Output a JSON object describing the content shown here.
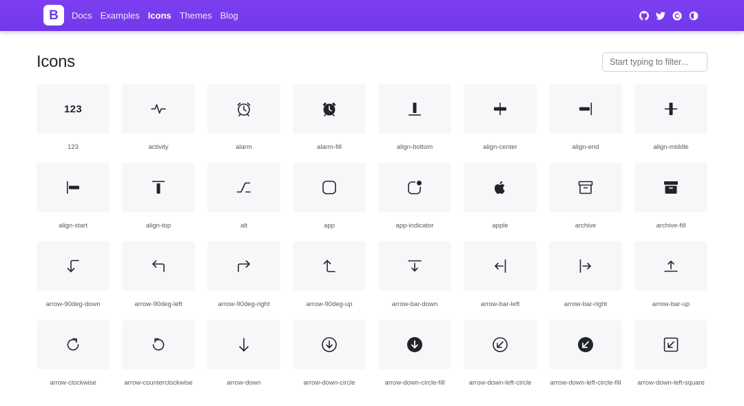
{
  "nav": {
    "brand_letter": "B",
    "links": [
      {
        "label": "Docs",
        "active": false
      },
      {
        "label": "Examples",
        "active": false
      },
      {
        "label": "Icons",
        "active": true
      },
      {
        "label": "Themes",
        "active": false
      },
      {
        "label": "Blog",
        "active": false
      }
    ],
    "icons": [
      "github-icon",
      "twitter-icon",
      "opencollective-icon",
      "theme-toggle-icon"
    ]
  },
  "page": {
    "title": "Icons",
    "filter_placeholder": "Start typing to filter..."
  },
  "icons": [
    {
      "label": "123",
      "icon": "123"
    },
    {
      "label": "activity",
      "icon": "activity"
    },
    {
      "label": "alarm",
      "icon": "alarm"
    },
    {
      "label": "alarm-fill",
      "icon": "alarm-fill"
    },
    {
      "label": "align-bottom",
      "icon": "align-bottom"
    },
    {
      "label": "align-center",
      "icon": "align-center"
    },
    {
      "label": "align-end",
      "icon": "align-end"
    },
    {
      "label": "align-middle",
      "icon": "align-middle"
    },
    {
      "label": "align-start",
      "icon": "align-start"
    },
    {
      "label": "align-top",
      "icon": "align-top"
    },
    {
      "label": "alt",
      "icon": "alt"
    },
    {
      "label": "app",
      "icon": "app"
    },
    {
      "label": "app-indicator",
      "icon": "app-indicator"
    },
    {
      "label": "apple",
      "icon": "apple"
    },
    {
      "label": "archive",
      "icon": "archive"
    },
    {
      "label": "archive-fill",
      "icon": "archive-fill"
    },
    {
      "label": "arrow-90deg-down",
      "icon": "arrow-90deg-down"
    },
    {
      "label": "arrow-90deg-left",
      "icon": "arrow-90deg-left"
    },
    {
      "label": "arrow-90deg-right",
      "icon": "arrow-90deg-right"
    },
    {
      "label": "arrow-90deg-up",
      "icon": "arrow-90deg-up"
    },
    {
      "label": "arrow-bar-down",
      "icon": "arrow-bar-down"
    },
    {
      "label": "arrow-bar-left",
      "icon": "arrow-bar-left"
    },
    {
      "label": "arrow-bar-right",
      "icon": "arrow-bar-right"
    },
    {
      "label": "arrow-bar-up",
      "icon": "arrow-bar-up"
    },
    {
      "label": "arrow-clockwise",
      "icon": "arrow-clockwise"
    },
    {
      "label": "arrow-counterclockwise",
      "icon": "arrow-counterclockwise"
    },
    {
      "label": "arrow-down",
      "icon": "arrow-down"
    },
    {
      "label": "arrow-down-circle",
      "icon": "arrow-down-circle"
    },
    {
      "label": "arrow-down-circle-fill",
      "icon": "arrow-down-circle-fill"
    },
    {
      "label": "arrow-down-left-circle",
      "icon": "arrow-down-left-circle"
    },
    {
      "label": "arrow-down-left-circle-fill",
      "icon": "arrow-down-left-circle-fill"
    },
    {
      "label": "arrow-down-left-square",
      "icon": "arrow-down-left-square"
    }
  ]
}
